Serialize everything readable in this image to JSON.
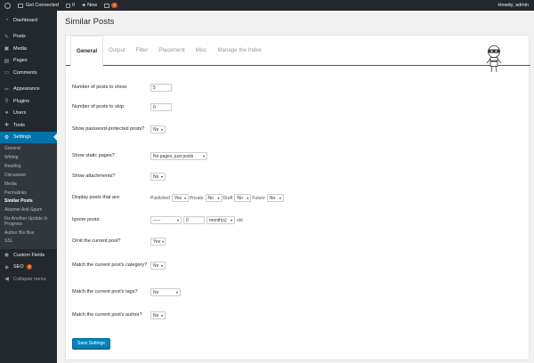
{
  "adminbar": {
    "site_name": "Get Connected",
    "comments_count": "0",
    "new_label": "New",
    "updates_count": "3",
    "howdy": "Howdy, admin"
  },
  "sidebar": {
    "items": [
      {
        "label": "Dashboard",
        "icon": "dashboard-icon"
      },
      {
        "label": "Posts",
        "icon": "pin-icon"
      },
      {
        "label": "Media",
        "icon": "media-icon"
      },
      {
        "label": "Pages",
        "icon": "pages-icon"
      },
      {
        "label": "Comments",
        "icon": "comments-icon"
      },
      {
        "label": "Appearance",
        "icon": "brush-icon"
      },
      {
        "label": "Plugins",
        "icon": "plugin-icon"
      },
      {
        "label": "Users",
        "icon": "users-icon"
      },
      {
        "label": "Tools",
        "icon": "wrench-icon"
      },
      {
        "label": "Settings",
        "icon": "settings-icon"
      }
    ],
    "settings_sub": [
      "General",
      "Writing",
      "Reading",
      "Discussion",
      "Media",
      "Permalinks",
      "Similar Posts",
      "Akismet Anti-Spam",
      "Fix Another Update In Progress",
      "Author Bio Box",
      "SSL"
    ],
    "custom_fields": "Custom Fields",
    "seo": "SEO",
    "seo_badge": "3",
    "collapse": "Collapse menu"
  },
  "page": {
    "title": "Similar Posts",
    "tabs": [
      "General",
      "Output",
      "Filter",
      "Placement",
      "Misc",
      "Manage the Index"
    ]
  },
  "form": {
    "num_posts_label": "Number of posts to show:",
    "num_posts_value": "5",
    "skip_label": "Number of posts to skip:",
    "skip_value": "0",
    "password_label": "Show password-protected posts?",
    "password_value": "No",
    "static_label": "Show static pages?",
    "static_value": "No pages, just posts",
    "attach_label": "Show attachments?",
    "attach_value": "No",
    "display_label": "Display posts that are:",
    "published_label": "Published",
    "published_value": "Yes",
    "private_label": "Private",
    "private_value": "No",
    "draft_label": "Draft",
    "draft_value": "No",
    "future_label": "Future",
    "future_value": "No",
    "ignore_label": "Ignore posts:",
    "ignore_select_value": "-----",
    "ignore_number_value": "0",
    "ignore_unit_value": "month(s)",
    "ignore_suffix": "old",
    "omit_label": "Omit the current post?",
    "omit_value": "Yes",
    "category_label": "Match the current post's category?",
    "category_value": "No",
    "tags_label": "Match the current post's tags?",
    "tags_value": "No",
    "author_label": "Match the current post's author?",
    "author_value": "No",
    "save_label": "Save Settings"
  },
  "colors": {
    "accent": "#0073aa",
    "admin_dark": "#23282d",
    "badge": "#d54e21"
  }
}
